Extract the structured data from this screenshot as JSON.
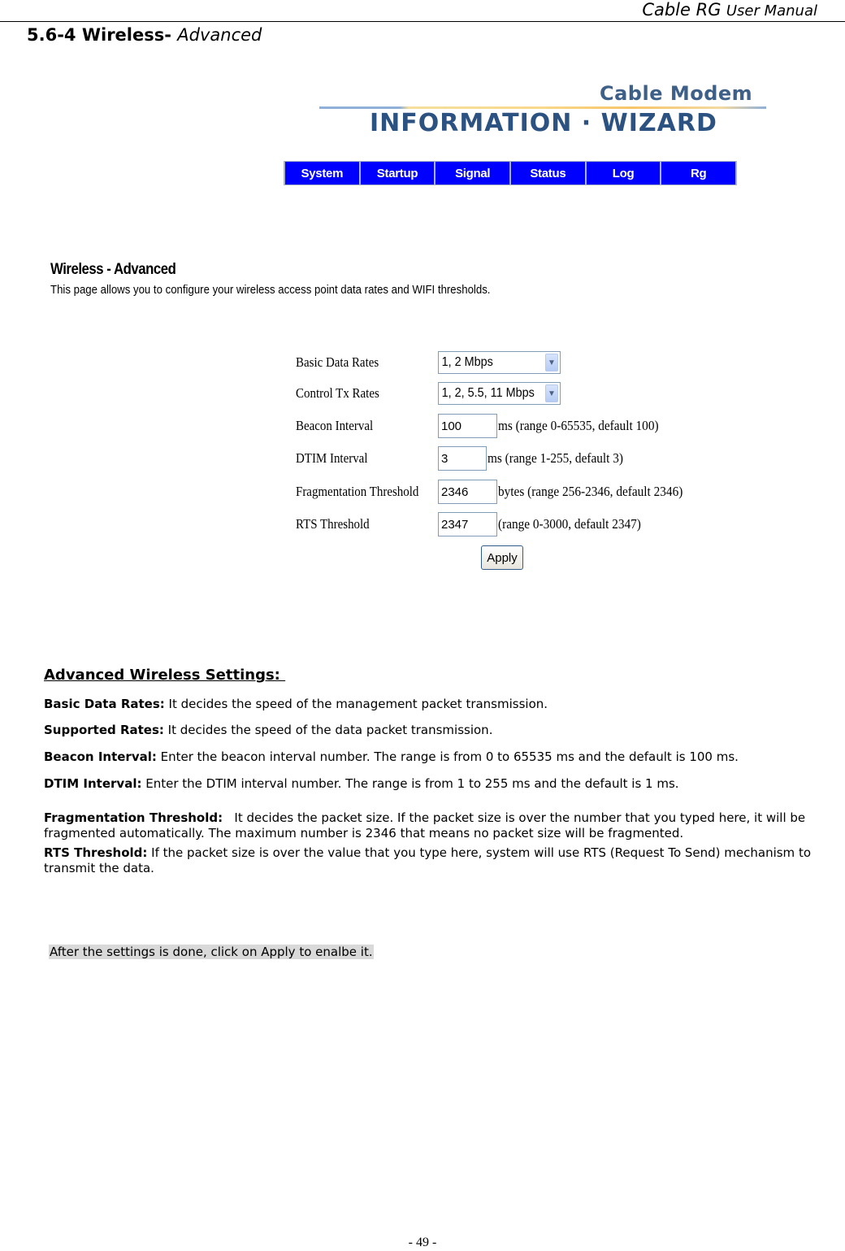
{
  "running_header": {
    "brand": "Cable RG",
    "title": "User Manual"
  },
  "section": {
    "number_title": "5.6-4 Wireless-",
    "subtitle": "Advanced"
  },
  "logo": {
    "top": "Cable Modem",
    "main": "INFORMATION · WIZARD"
  },
  "nav": {
    "items": [
      {
        "label": "System"
      },
      {
        "label": "Startup"
      },
      {
        "label": "Signal"
      },
      {
        "label": "Status"
      },
      {
        "label": "Log"
      },
      {
        "label": "Rg"
      }
    ],
    "colors": {
      "background": "#0000ff",
      "text": "#ffffff"
    }
  },
  "page": {
    "heading": "Wireless - Advanced",
    "description": "This page allows you to configure your wireless access point data rates and WIFI thresholds."
  },
  "form": {
    "basic_data_rates": {
      "label": "Basic Data Rates",
      "value": "1, 2 Mbps"
    },
    "control_tx_rates": {
      "label": "Control Tx Rates",
      "value": "1, 2, 5.5, 11 Mbps"
    },
    "beacon_interval": {
      "label": "Beacon Interval",
      "value": "100",
      "hint": "ms (range 0-65535, default 100)"
    },
    "dtim_interval": {
      "label": "DTIM Interval",
      "value": "3",
      "hint": "ms (range 1-255, default 3)"
    },
    "fragmentation_threshold": {
      "label": "Fragmentation Threshold",
      "value": "2346",
      "hint": "bytes (range 256-2346, default 2346)"
    },
    "rts_threshold": {
      "label": "RTS Threshold",
      "value": "2347",
      "hint": "(range 0-3000, default 2347)"
    },
    "apply_label": "Apply"
  },
  "doc": {
    "heading": "Advanced Wireless Settings: ",
    "paragraphs": [
      {
        "term": "Basic Data Rates:",
        "text": " It decides the speed of the management packet transmission."
      },
      {
        "term": "Supported Rates:",
        "text": " It decides the speed of the data packet transmission."
      },
      {
        "term": "Beacon Interval:",
        "text": " Enter the beacon interval number. The range is from 0 to 65535 ms and the default is 100 ms."
      },
      {
        "term": "DTIM Interval:",
        "text": " Enter the DTIM interval number. The range is from 1 to 255 ms and the default is 1 ms."
      },
      {
        "term": "Fragmentation Threshold:",
        "text": "   It decides the packet size. If the packet size is over the number that you typed here, it will be fragmented automatically. The maximum number is 2346 that means no packet size will be fragmented."
      },
      {
        "term": "RTS Threshold:",
        "text": " If the packet size is over the value that you type here, system will use RTS (Request To Send) mechanism to transmit the data."
      }
    ],
    "note": "After the settings is done, click on Apply to enalbe it."
  },
  "footer": {
    "page_number": "- 49 -"
  }
}
